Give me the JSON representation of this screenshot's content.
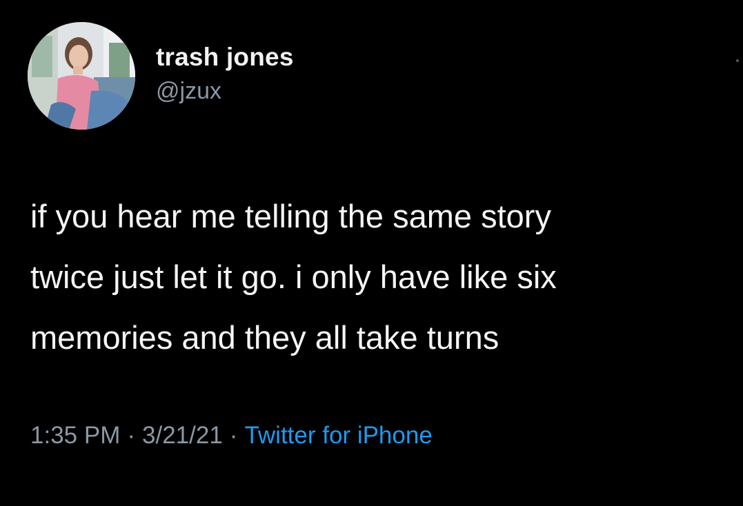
{
  "tweet": {
    "display_name": "trash jones",
    "handle": "@jzux",
    "body_lines": [
      "if you hear me telling the same story",
      "twice just let it go. i only have like six",
      "memories and they all take turns"
    ],
    "time": "1:35 PM",
    "date": "3/21/21",
    "separator": "·",
    "source": "Twitter for iPhone"
  },
  "colors": {
    "background": "#000000",
    "text": "#f5f5f5",
    "secondary": "#8b98a5",
    "link": "#1d9bf0"
  },
  "icons": {
    "avatar": "profile-photo",
    "more": "more-options-dot"
  }
}
